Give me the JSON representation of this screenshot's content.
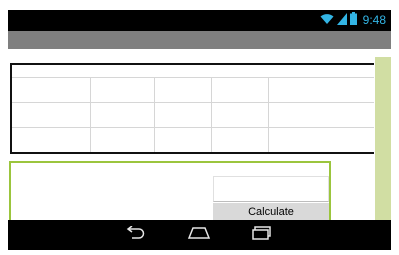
{
  "status_bar": {
    "time": "9:48",
    "icons": [
      "wifi-icon",
      "signal-icon",
      "battery-icon"
    ]
  },
  "table": {
    "rows": 3,
    "columns": 5
  },
  "form": {
    "input_value": "",
    "button_label": "Calculate"
  },
  "nav": {
    "buttons": [
      "back-icon",
      "home-icon",
      "recents-icon"
    ]
  },
  "colors": {
    "status_bar": "#000000",
    "title_bar": "#7f7f7f",
    "clock": "#33b5e5",
    "right_strip": "#d1dea3",
    "form_border": "#9bc53d",
    "button_bg": "#d9d9d9"
  }
}
